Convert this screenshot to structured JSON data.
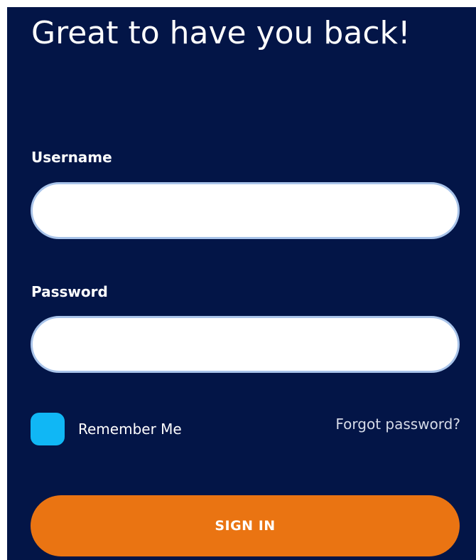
{
  "heading": "Great to have you back!",
  "username": {
    "label": "Username",
    "value": "",
    "placeholder": ""
  },
  "password": {
    "label": "Password",
    "value": "",
    "placeholder": ""
  },
  "remember": {
    "label": "Remember Me"
  },
  "forgot_link": "Forgot password?",
  "signin_label": "SIGN IN",
  "colors": {
    "panel_background": "#031547",
    "checkbox": "#10b7f5",
    "button": "#ea7412",
    "input_border": "#a9c4ea"
  }
}
